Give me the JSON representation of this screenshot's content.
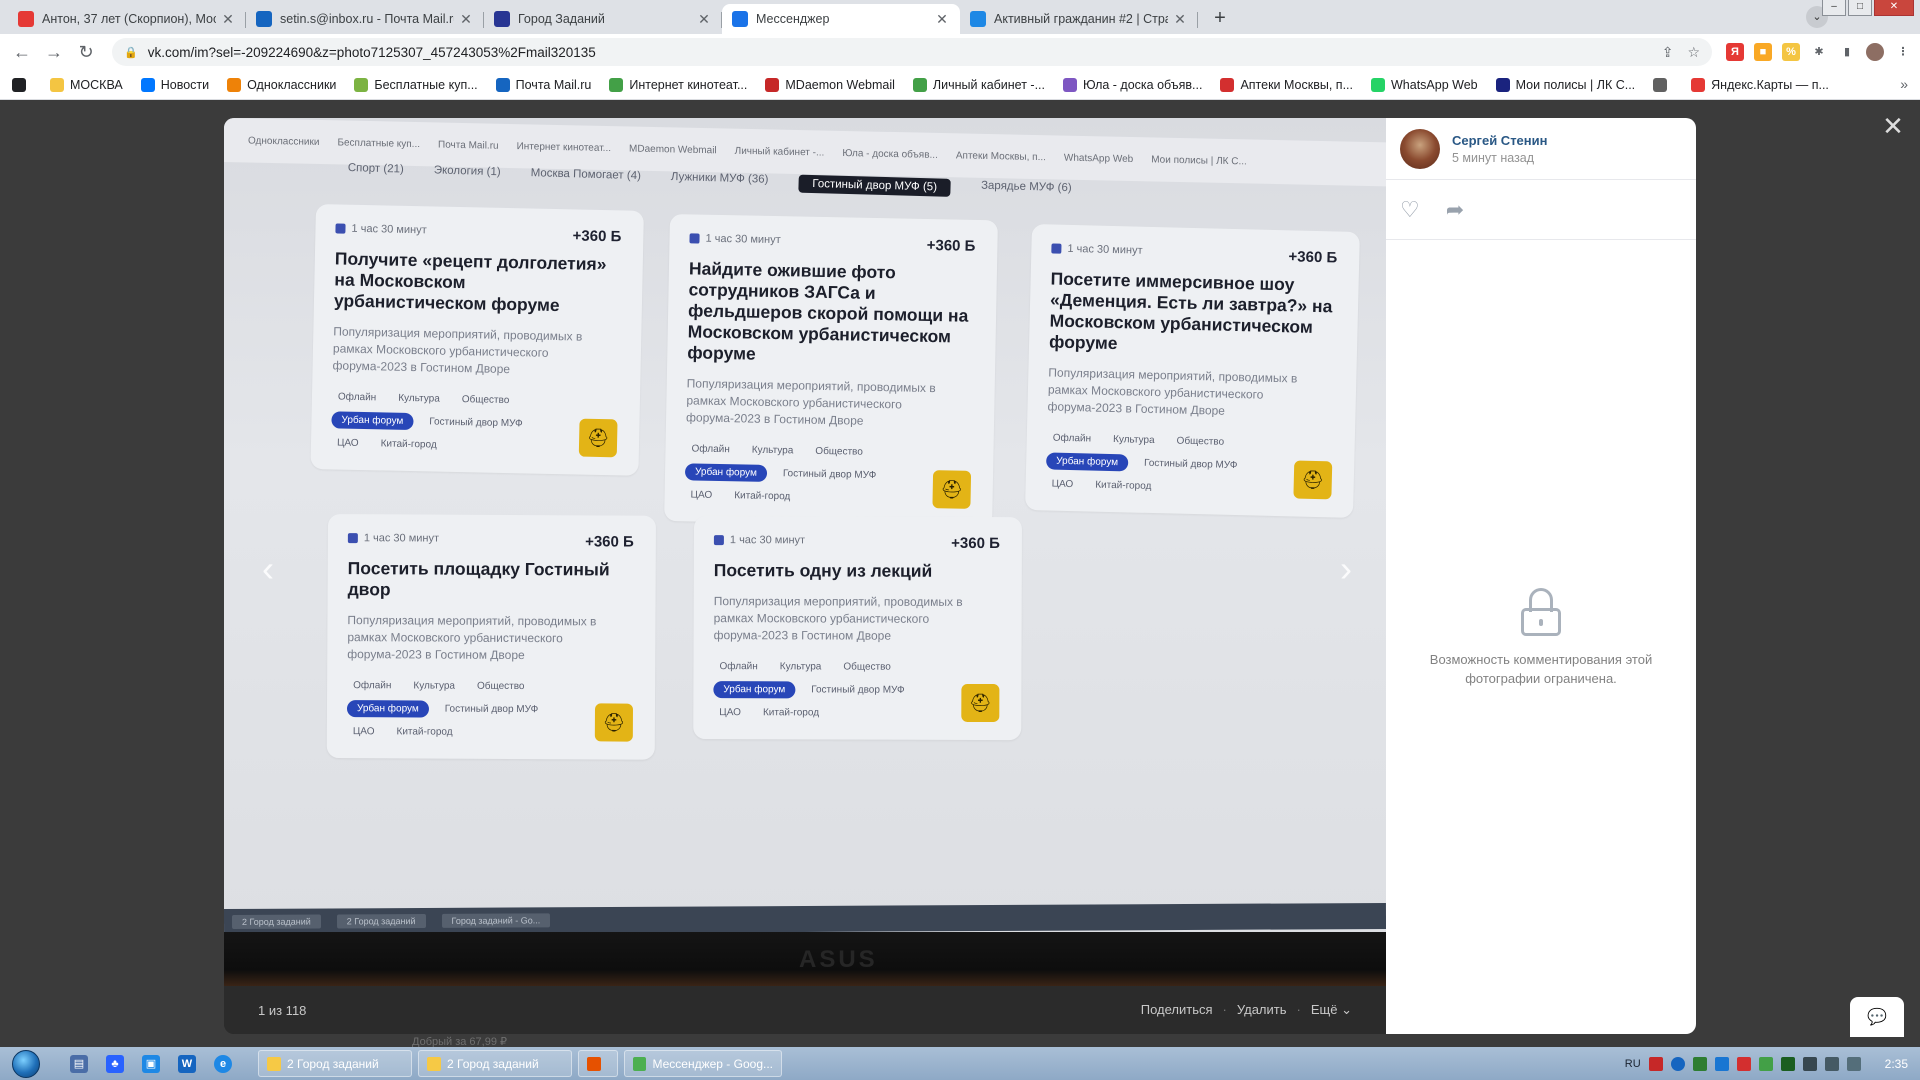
{
  "browser": {
    "tabs": [
      {
        "label": "Антон, 37 лет (Скорпион), Моск",
        "icon": "odnoklassniki-icon",
        "color": "#e53935",
        "active": false
      },
      {
        "label": "setin.s@inbox.ru - Почта Mail.ru",
        "icon": "mail-icon",
        "color": "#1565c0",
        "active": false
      },
      {
        "label": "Город Заданий",
        "icon": "city-icon",
        "color": "#283593",
        "active": false
      },
      {
        "label": "Мессенджер",
        "icon": "vk-messenger-icon",
        "color": "#1a73e8",
        "active": true
      },
      {
        "label": "Активный гражданин #2 | Стра",
        "icon": "ag-icon",
        "color": "#1e88e5",
        "active": false
      }
    ],
    "url": "vk.com/im?sel=-209224690&z=photo7125307_457243053%2Fmail320135",
    "bookmarks": [
      {
        "label": "",
        "icon": "plus-circle-icon",
        "color": "#202124"
      },
      {
        "label": "МОСКВА",
        "icon": "folder-icon",
        "color": "#f4c542"
      },
      {
        "label": "Новости",
        "icon": "vk-icon",
        "color": "#0077ff"
      },
      {
        "label": "Одноклассники",
        "icon": "ok-icon",
        "color": "#ee8208"
      },
      {
        "label": "Бесплатные куп...",
        "icon": "coupon-icon",
        "color": "#7cb342"
      },
      {
        "label": "Почта Mail.ru",
        "icon": "mail-icon",
        "color": "#1565c0"
      },
      {
        "label": "Интернет кинотеат...",
        "icon": "cinema-icon",
        "color": "#43a047"
      },
      {
        "label": "MDaemon Webmail",
        "icon": "mdaemon-icon",
        "color": "#c62828"
      },
      {
        "label": "Личный кабинет -...",
        "icon": "cabinet-icon",
        "color": "#43a047"
      },
      {
        "label": "Юла - доска объяв...",
        "icon": "yula-icon",
        "color": "#7e57c2"
      },
      {
        "label": "Аптеки Москвы, п...",
        "icon": "pharmacy-icon",
        "color": "#d32f2f"
      },
      {
        "label": "WhatsApp Web",
        "icon": "whatsapp-icon",
        "color": "#25d366"
      },
      {
        "label": "Мои полисы | ЛК С...",
        "icon": "policy-icon",
        "color": "#1a237e"
      },
      {
        "label": "",
        "icon": "globe-icon",
        "color": "#616161"
      },
      {
        "label": "Яндекс.Карты — п...",
        "icon": "yandex-maps-icon",
        "color": "#e53935"
      }
    ]
  },
  "photo": {
    "filters": [
      "Спорт (21)",
      "Экология (1)",
      "Москва Помогает (4)",
      "Лужники МУФ (36)",
      "Гостиный двор МУФ (5)",
      "Зарядье МУФ (6)"
    ],
    "active_filter": "Гостиный двор МУФ (5)",
    "inner_bookmarks": [
      "Одноклассники",
      "Бесплатные куп...",
      "Почта Mail.ru",
      "Интернет кинотеат...",
      "MDaemon Webmail",
      "Личный кабинет -...",
      "Юла - доска объяв...",
      "Аптеки Москвы, п...",
      "WhatsApp Web",
      "Мои полисы | ЛК С..."
    ],
    "cards": [
      {
        "time": "1 час 30 минут",
        "points": "+360 Б",
        "title": "Получите «рецепт долголетия» на Московском урбанистическом форуме",
        "desc": "Популяризация мероприятий, проводимых в рамках Московского урбанистического форума-2023 в Гостином Дворе",
        "tags": [
          "Офлайн",
          "Культура",
          "Общество",
          "Урбан форум",
          "Гостиный двор МУФ",
          "ЦАО",
          "Китай-город"
        ]
      },
      {
        "time": "1 час 30 минут",
        "points": "+360 Б",
        "title": "Найдите ожившие фото сотрудников ЗАГСа и фельдшеров скорой помощи на Московском урбанистическом форуме",
        "desc": "Популяризация мероприятий, проводимых в рамках Московского урбанистического форума-2023 в Гостином Дворе",
        "tags": [
          "Офлайн",
          "Культура",
          "Общество",
          "Урбан форум",
          "Гостиный двор МУФ",
          "ЦАО",
          "Китай-город"
        ]
      },
      {
        "time": "1 час 30 минут",
        "points": "+360 Б",
        "title": "Посетите иммерсивное шоу «Деменция. Есть ли завтра?» на Московском урбанистическом форуме",
        "desc": "Популяризация мероприятий, проводимых в рамках Московского урбанистического форума-2023 в Гостином Дворе",
        "tags": [
          "Офлайн",
          "Культура",
          "Общество",
          "Урбан форум",
          "Гостиный двор МУФ",
          "ЦАО",
          "Китай-город"
        ]
      },
      {
        "time": "1 час 30 минут",
        "points": "+360 Б",
        "title": "Посетить площадку Гостиный двор",
        "desc": "Популяризация мероприятий, проводимых в рамках Московского урбанистического форума-2023 в Гостином Дворе",
        "tags": [
          "Офлайн",
          "Культура",
          "Общество",
          "Урбан форум",
          "Гостиный двор МУФ",
          "ЦАО",
          "Китай-город"
        ]
      },
      {
        "time": "1 час 30 минут",
        "points": "+360 Б",
        "title": "Посетить одну из лекций",
        "desc": "Популяризация мероприятий, проводимых в рамках Московского урбанистического форума-2023 в Гостином Дворе",
        "tags": [
          "Офлайн",
          "Культура",
          "Общество",
          "Урбан форум",
          "Гостиный двор МУФ",
          "ЦАО",
          "Китай-город"
        ]
      }
    ],
    "highlight_tag": "Урбан форум",
    "inner_taskbar": [
      "2 Город заданий",
      "2 Город заданий",
      "Город заданий - Go..."
    ],
    "monitor_brand": "ASUS",
    "counter": "1 из 118",
    "share_label": "Поделиться",
    "delete_label": "Удалить",
    "more_label": "Ещё"
  },
  "side": {
    "author": "Сергей Стенин",
    "posted": "5 минут назад",
    "locked_text": "Возможность комментирования этой фотографии ограничена."
  },
  "below_notice": "Добрый за 67,99 ₽",
  "taskbar": {
    "tasks": [
      {
        "label": "2 Город заданий",
        "color": "#f6c945"
      },
      {
        "label": "2 Город заданий",
        "color": "#f6c945"
      },
      {
        "label": "",
        "color": "#e65100"
      },
      {
        "label": "Мессенджер - Goog...",
        "color": "#4caf50"
      }
    ],
    "lang": "RU",
    "clock": "2:35"
  },
  "colors": {
    "vk_link": "#2a5885",
    "accent_tag": "#2846b8",
    "badge": "#e3b416"
  }
}
